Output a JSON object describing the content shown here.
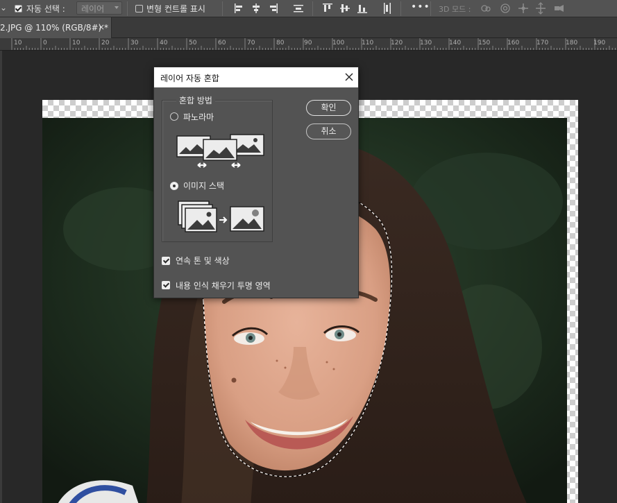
{
  "optionsbar": {
    "auto_select_label": "자동 선택 :",
    "auto_select_checked": true,
    "auto_select_target": "레이어",
    "show_transform_label": "변형 컨트롤 표시",
    "show_transform_checked": false,
    "more_label": "•••",
    "mode_3d_label": "3D 모드 :"
  },
  "tab": {
    "title": "2.JPG @ 110% (RGB/8#) *",
    "close": "×"
  },
  "ruler": {
    "labels": [
      "10",
      "0",
      "10",
      "20",
      "30",
      "40",
      "50",
      "60",
      "70",
      "80",
      "90",
      "100",
      "110",
      "120",
      "130",
      "140",
      "150",
      "160",
      "170",
      "180",
      "190"
    ]
  },
  "dialog": {
    "title": "레이어 자동 혼합",
    "close_icon": "close-icon",
    "blend_method_legend": "혼합 방법",
    "panorama_label": "파노라마",
    "panorama_selected": false,
    "image_stack_label": "이미지 스택",
    "image_stack_selected": true,
    "ok_label": "확인",
    "cancel_label": "취소",
    "seamless_tones_label": "연속 톤 및 색상",
    "seamless_tones_checked": true,
    "content_aware_fill_label": "내용 인식 채우기 투명 영역",
    "content_aware_fill_checked": true
  },
  "colors": {
    "panel": "#535353",
    "workspace": "#282828",
    "titlebar": "#ffffff"
  }
}
